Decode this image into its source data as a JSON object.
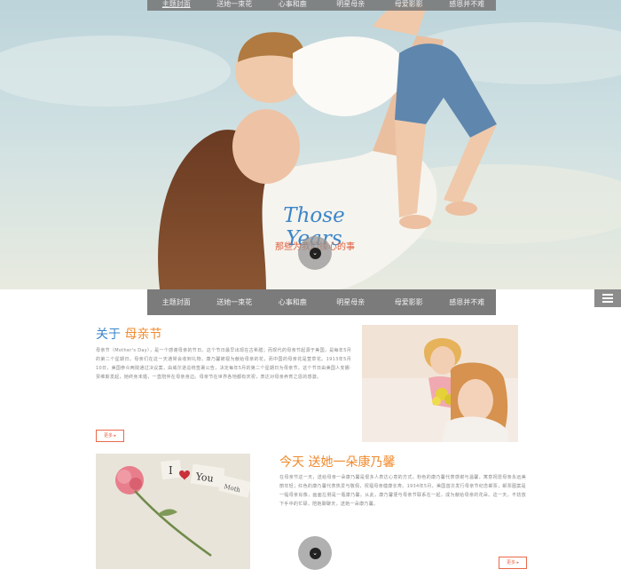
{
  "nav": {
    "items": [
      "主题封面",
      "送她一束花",
      "心事和鹿",
      "明星母亲",
      "母爱影影",
      "感恩并不难"
    ],
    "main_items": [
      "主题封面",
      "送她一束花",
      "心事和鹿",
      "明星母亲",
      "母爱影影",
      "感恩并不难"
    ]
  },
  "hero": {
    "tag": "心事和鹿",
    "title": "Those Years",
    "subtitle": "那些为我们操心的事"
  },
  "section1": {
    "title_lead": "关于",
    "title_highlight": "母亲节",
    "body": "母亲节（Mother's Day），是一个感谢母亲的节日。这个节日最早出现在古希腊；而现代的母亲节起源于美国，是每年5月的第二个星期日。母亲们在这一天通常会收到礼物，康乃馨被视为献给母亲的花，而中国的母亲花是萱草花。1913年5月10日，美国参众两院通过决议案，由威尔逊总统签署公告，决定每年5月的第二个星期日为母亲节。这个节日由美国人安娜·贾维斯发起，她终身未婚，一直陪伴在母亲身边。母亲节在世界各地都有庆祝，表达对母亲养育之恩的感激。",
    "more": "更多 ▸"
  },
  "section2": {
    "title_lead": "今天",
    "title_highlight": "送她一朵康乃馨",
    "body": "在母亲节这一天，送给母亲一朵康乃馨是很多人表达心意的方式。粉色的康乃馨代表感谢与温馨，寓意祝愿母亲永远美丽年轻；红色的康乃馨代表热爱与敬佩，祝福母亲健康长寿。1934年5月，美国首次发行母亲节纪念邮票，邮票图案是一幅母亲肖像，画面左侧是一瓶康乃馨。从此，康乃馨便与母亲节联系在一起，成为献给母亲的花朵。这一天，不妨放下手中的忙碌，陪她聊聊天，送她一朵康乃馨。",
    "more": "更多 ▸"
  },
  "photo2_card": {
    "letters": [
      "I",
      "You",
      "Moth"
    ]
  },
  "colors": {
    "accent_blue": "#3b86c9",
    "accent_orange": "#f08a2d",
    "nav_gray": "#7b7b7b"
  },
  "icons": {
    "scroll": "chevron-down-icon",
    "menu": "hamburger-icon"
  }
}
